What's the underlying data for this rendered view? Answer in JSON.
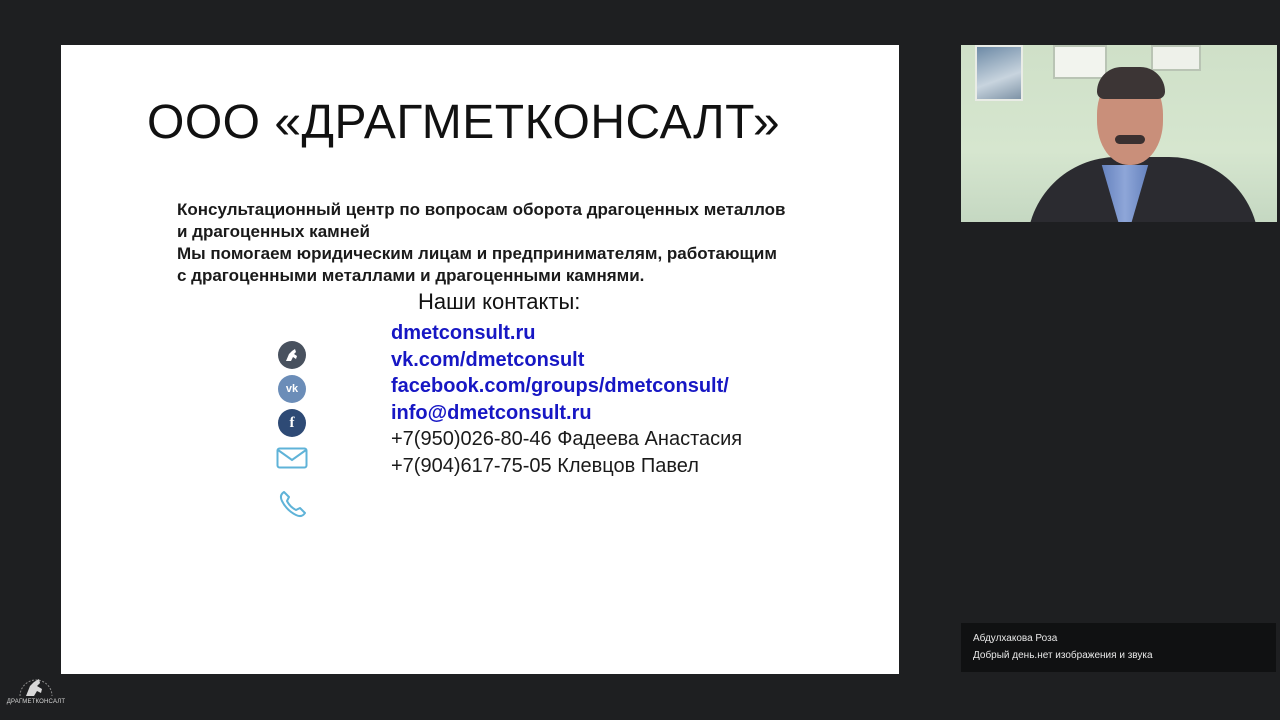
{
  "slide": {
    "title": "ООО «ДРАГМЕТКОНСАЛТ»",
    "description_lines": [
      "Консультационный центр по вопросам оборота драгоценных металлов",
      "и драгоценных камней",
      "Мы помогаем юридическим лицам и предпринимателям, работающим",
      "с драгоценными металлами и драгоценными камнями."
    ],
    "contacts_heading": "Наши контакты:",
    "links": [
      "dmetconsult.ru",
      "vk.com/dmetconsult",
      "facebook.com/groups/dmetconsult/",
      "info@dmetconsult.ru"
    ],
    "phones": [
      "+7(950)026-80-46 Фадеева Анастасия",
      "+7(904)617-75-05 Клевцов Павел"
    ],
    "icons": [
      "company-logo-icon",
      "vk-icon",
      "facebook-icon",
      "mail-icon",
      "phone-icon"
    ],
    "link_color": "#1717c4"
  },
  "chat": {
    "author": "Абдулхакова Роза",
    "message": "Добрый день.нет изображения и звука"
  },
  "branding": {
    "logo_text": "ДРАГМЕТКОНСАЛТ"
  }
}
